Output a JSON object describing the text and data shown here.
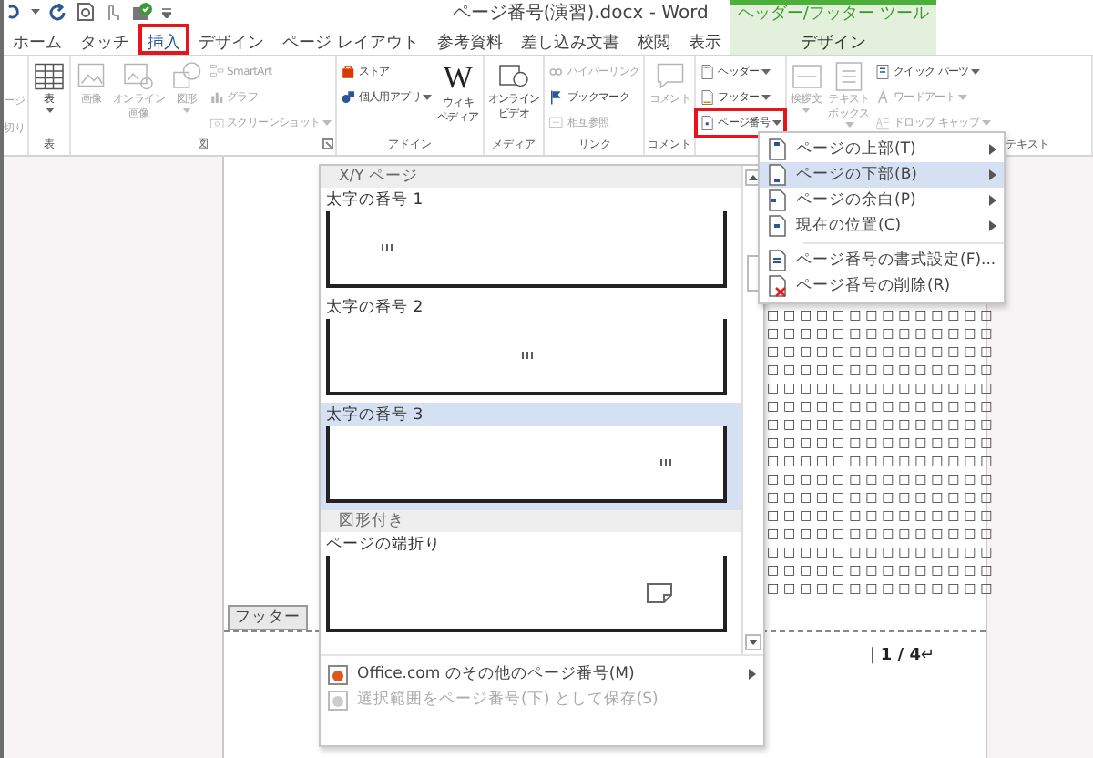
{
  "window": {
    "title": "ページ番号(演習).docx - Word",
    "contextual_header": "ヘッダー/フッター ツール"
  },
  "tabs": [
    {
      "label": "ホーム",
      "selected": false,
      "highlighted": false,
      "contextual": false
    },
    {
      "label": "タッチ",
      "selected": false,
      "highlighted": false,
      "contextual": false
    },
    {
      "label": "挿入",
      "selected": true,
      "highlighted": true,
      "contextual": false
    },
    {
      "label": "デザイン",
      "selected": false,
      "highlighted": false,
      "contextual": false
    },
    {
      "label": "ページ レイアウト",
      "selected": false,
      "highlighted": false,
      "contextual": false
    },
    {
      "label": "参考資料",
      "selected": false,
      "highlighted": false,
      "contextual": false
    },
    {
      "label": "差し込み文書",
      "selected": false,
      "highlighted": false,
      "contextual": false
    },
    {
      "label": "校閲",
      "selected": false,
      "highlighted": false,
      "contextual": false
    },
    {
      "label": "表示",
      "selected": false,
      "highlighted": false,
      "contextual": false
    },
    {
      "label": "デザイン",
      "selected": false,
      "highlighted": false,
      "contextual": true
    }
  ],
  "ribbon": {
    "cut_group": [
      "ージ",
      "切り"
    ],
    "groups": [
      {
        "label": "表",
        "items": [
          {
            "kind": "large",
            "lines": [
              "表"
            ],
            "dropdown": true,
            "disabled": false
          }
        ]
      },
      {
        "label": "図",
        "launcher": true,
        "items": [
          {
            "kind": "large",
            "lines": [
              "画像"
            ],
            "disabled": true
          },
          {
            "kind": "large",
            "lines": [
              "オンライン",
              "画像"
            ],
            "disabled": true
          },
          {
            "kind": "large",
            "lines": [
              "図形"
            ],
            "dropdown": true,
            "disabled": true
          },
          {
            "kind": "stack",
            "buttons": [
              {
                "label": "SmartArt",
                "disabled": true
              },
              {
                "label": "グラフ",
                "disabled": true
              },
              {
                "label": "スクリーンショット",
                "dropdown": true,
                "disabled": true
              }
            ]
          }
        ]
      },
      {
        "label": "アドイン",
        "items": [
          {
            "kind": "stack",
            "buttons": [
              {
                "label": "ストア",
                "disabled": false
              },
              {
                "label": "個人用アプリ",
                "dropdown": true,
                "disabled": false
              }
            ]
          },
          {
            "kind": "large",
            "logo": "W",
            "lines": [
              "ウィキ",
              "ペディア"
            ],
            "disabled": false
          }
        ]
      },
      {
        "label": "メディア",
        "items": [
          {
            "kind": "large",
            "lines": [
              "オンライン",
              "ビデオ"
            ],
            "disabled": false
          }
        ]
      },
      {
        "label": "リンク",
        "items": [
          {
            "kind": "stack",
            "buttons": [
              {
                "label": "ハイパーリンク",
                "disabled": true
              },
              {
                "label": "ブックマーク",
                "disabled": false
              },
              {
                "label": "相互参照",
                "disabled": true
              }
            ]
          }
        ]
      },
      {
        "label": "コメント",
        "items": [
          {
            "kind": "large",
            "lines": [
              "コメント"
            ],
            "disabled": true
          }
        ]
      },
      {
        "items": [
          {
            "kind": "stack",
            "buttons": [
              {
                "label": "ヘッダー",
                "dropdown": true,
                "disabled": false,
                "highlighted": false
              },
              {
                "label": "フッター",
                "dropdown": true,
                "disabled": false,
                "highlighted": false
              },
              {
                "label": "ページ番号",
                "dropdown": true,
                "disabled": false,
                "highlighted": true
              }
            ]
          }
        ]
      },
      {
        "label": "テキスト",
        "items": [
          {
            "kind": "large",
            "lines": [
              "挨拶文"
            ],
            "dropdown": true,
            "disabled": true
          },
          {
            "kind": "large",
            "lines": [
              "テキスト",
              "ボックス"
            ],
            "dropdown": true,
            "disabled": true
          },
          {
            "kind": "stack",
            "buttons": [
              {
                "label": "クイック パーツ",
                "dropdown": true,
                "disabled": false
              },
              {
                "label": "ワードアート",
                "dropdown": true,
                "disabled": true
              },
              {
                "label": "ドロップ キャップ",
                "dropdown": true,
                "disabled": true
              }
            ]
          }
        ]
      }
    ]
  },
  "document": {
    "lines": [
      "□□□□□□□□□□□□□□",
      "□□□□□□□□□□□□□□",
      "□□□□□□□□□□□□□□",
      "□□□□□□□□□□□□□□",
      "□□□□□□□□□□□□□□",
      "□□□□□□□□□□□□□□",
      "□□□□□□□□□□□□□□",
      "□□□□□□□□□□□□□□",
      "□□□□□□□□□□□□□□",
      "□□□□□□□□□□□□□□",
      "□□□□□□□□□□□□□□",
      "□□□□□□□□□□□□□□",
      "□□□□□□□□□□□□□□",
      "□□□□□□□□□□□□□□",
      "□□□□□□□□□□□□□□",
      "□□□□□□□□□□□□□□"
    ],
    "footer_label": "フッター",
    "page_number": "| **1 / 4**↵"
  },
  "gallery": {
    "sections": [
      {
        "title": "X/Y ページ",
        "items": [
          {
            "label": "太字の番号 1",
            "kind": "number",
            "selected": false
          },
          {
            "label": "太字の番号 2",
            "kind": "number",
            "selected": false
          },
          {
            "label": "太字の番号 3",
            "kind": "number",
            "selected": true
          }
        ]
      },
      {
        "title": "図形付き",
        "items": [
          {
            "label": "ページの端折り",
            "kind": "folded",
            "selected": false
          }
        ]
      }
    ],
    "footer_items": [
      {
        "label": "Office.com のその他のページ番号(M)",
        "submenu": true,
        "disabled": false
      },
      {
        "label": "選択範囲をページ番号(下) として保存(S)",
        "submenu": false,
        "disabled": true
      }
    ]
  },
  "submenu": {
    "items": [
      {
        "label": "ページの上部(T)",
        "kind": "submenu",
        "selected": false
      },
      {
        "label": "ページの下部(B)",
        "kind": "submenu",
        "selected": true
      },
      {
        "label": "ページの余白(P)",
        "kind": "submenu",
        "selected": false
      },
      {
        "label": "現在の位置(C)",
        "kind": "submenu",
        "selected": false
      },
      {
        "label": "ページ番号の書式設定(F)...",
        "kind": "command",
        "selected": false
      },
      {
        "label": "ページ番号の削除(R)",
        "kind": "command",
        "selected": false
      }
    ]
  }
}
